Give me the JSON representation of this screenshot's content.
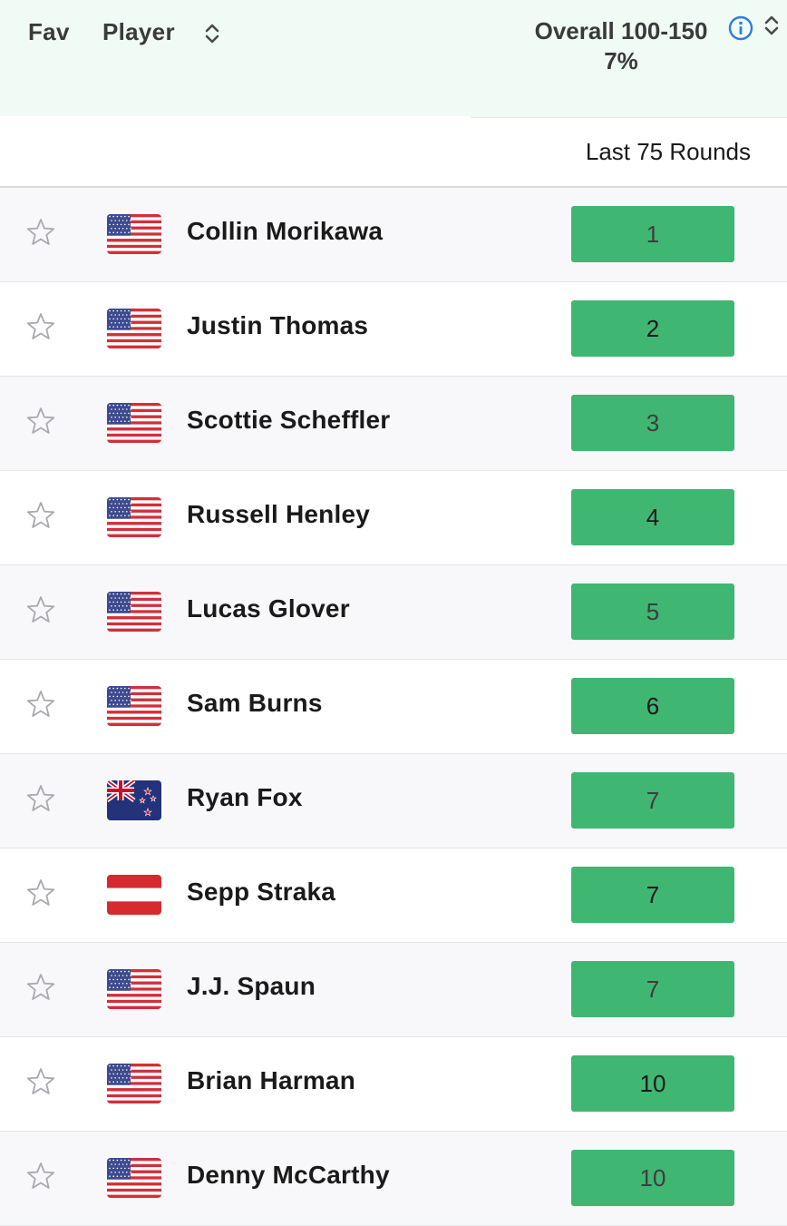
{
  "header": {
    "fav_label": "Fav",
    "player_label": "Player",
    "overall_label": "Overall 100-150",
    "overall_pct": "7%",
    "subheader": "Last 75 Rounds"
  },
  "colors": {
    "header_bg": "#f1fbf6",
    "rank_bg": "#3fb672",
    "info_blue": "#2a7de1"
  },
  "players": [
    {
      "name": "Collin Morikawa",
      "rank": "1",
      "flag": "usa-flag-icon"
    },
    {
      "name": "Justin Thomas",
      "rank": "2",
      "flag": "usa-flag-icon"
    },
    {
      "name": "Scottie Scheffler",
      "rank": "3",
      "flag": "usa-flag-icon"
    },
    {
      "name": "Russell Henley",
      "rank": "4",
      "flag": "usa-flag-icon"
    },
    {
      "name": "Lucas Glover",
      "rank": "5",
      "flag": "usa-flag-icon"
    },
    {
      "name": "Sam Burns",
      "rank": "6",
      "flag": "usa-flag-icon"
    },
    {
      "name": "Ryan Fox",
      "rank": "7",
      "flag": "new-zealand-flag-icon"
    },
    {
      "name": "Sepp Straka",
      "rank": "7",
      "flag": "austria-flag-icon"
    },
    {
      "name": "J.J. Spaun",
      "rank": "7",
      "flag": "usa-flag-icon"
    },
    {
      "name": "Brian Harman",
      "rank": "10",
      "flag": "usa-flag-icon"
    },
    {
      "name": "Denny McCarthy",
      "rank": "10",
      "flag": "usa-flag-icon"
    }
  ]
}
